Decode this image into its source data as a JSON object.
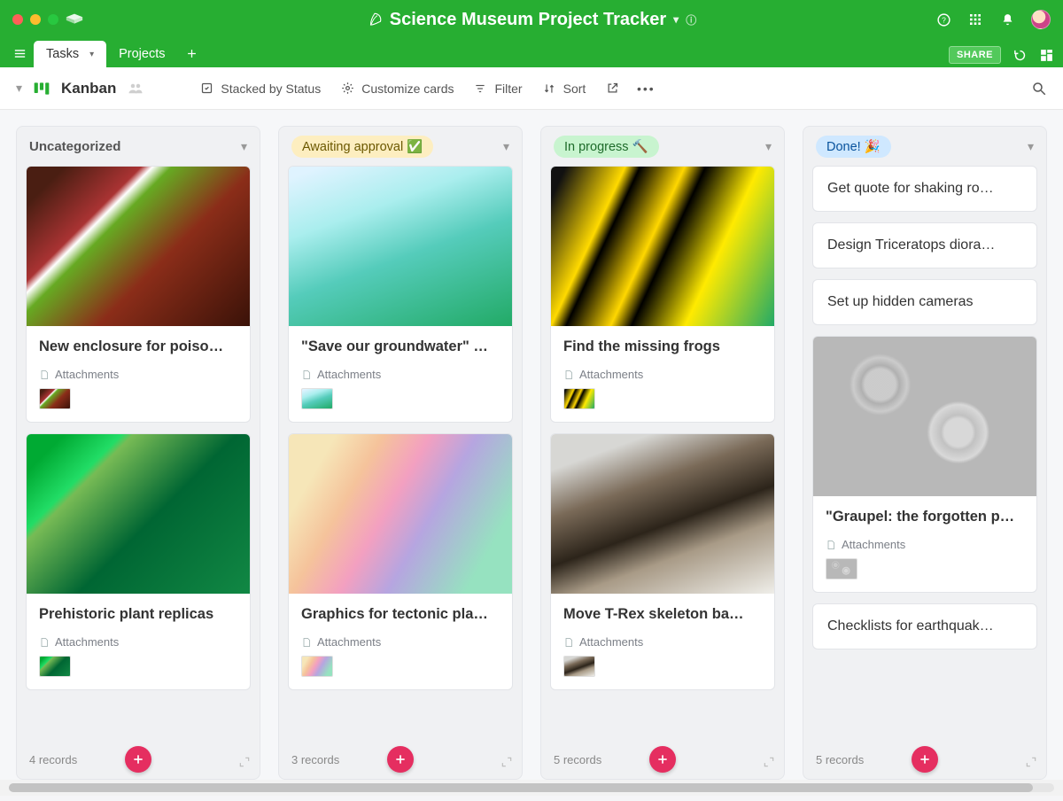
{
  "chrome": {
    "title": "Science Museum Project Tracker"
  },
  "tabs": {
    "active": "Tasks",
    "inactive": "Projects",
    "share": "SHARE"
  },
  "viewbar": {
    "view_name": "Kanban",
    "stacked": "Stacked by Status",
    "customize": "Customize cards",
    "filter": "Filter",
    "sort": "Sort"
  },
  "attachments_label": "Attachments",
  "columns": [
    {
      "key": "uncat",
      "title": "Uncategorized",
      "pill": "none",
      "footer": "4 records",
      "cards": [
        {
          "type": "rich",
          "title": "New enclosure for poiso…",
          "image": "img-frog1",
          "has_attachments": true
        },
        {
          "type": "rich",
          "title": "Prehistoric plant replicas",
          "image": "img-plant",
          "has_attachments": true
        }
      ]
    },
    {
      "key": "awaiting",
      "title": "Awaiting approval",
      "emoji": "✅",
      "pill": "yellow",
      "footer": "3 records",
      "cards": [
        {
          "type": "rich",
          "title": "\"Save our groundwater\" …",
          "image": "img-water",
          "has_attachments": true
        },
        {
          "type": "rich",
          "title": "Graphics for tectonic pla…",
          "image": "img-tect",
          "has_attachments": true
        }
      ]
    },
    {
      "key": "inprogress",
      "title": "In progress",
      "emoji": "🔨",
      "pill": "green",
      "footer": "5 records",
      "cards": [
        {
          "type": "rich",
          "title": "Find the missing frogs",
          "image": "img-frog2",
          "has_attachments": true
        },
        {
          "type": "rich",
          "title": "Move T-Rex skeleton ba…",
          "image": "img-trex",
          "has_attachments": true
        }
      ]
    },
    {
      "key": "done",
      "title": "Done!",
      "emoji": "🎉",
      "pill": "blue",
      "footer": "5 records",
      "cards": [
        {
          "type": "simple",
          "title": "Get quote for shaking ro…"
        },
        {
          "type": "simple",
          "title": "Design Triceratops diora…"
        },
        {
          "type": "simple",
          "title": "Set up hidden cameras"
        },
        {
          "type": "rich",
          "title": "\"Graupel: the forgotten p…",
          "image": "img-graupel",
          "has_attachments": true
        },
        {
          "type": "simple",
          "title": "Checklists for earthquak…"
        }
      ]
    }
  ]
}
